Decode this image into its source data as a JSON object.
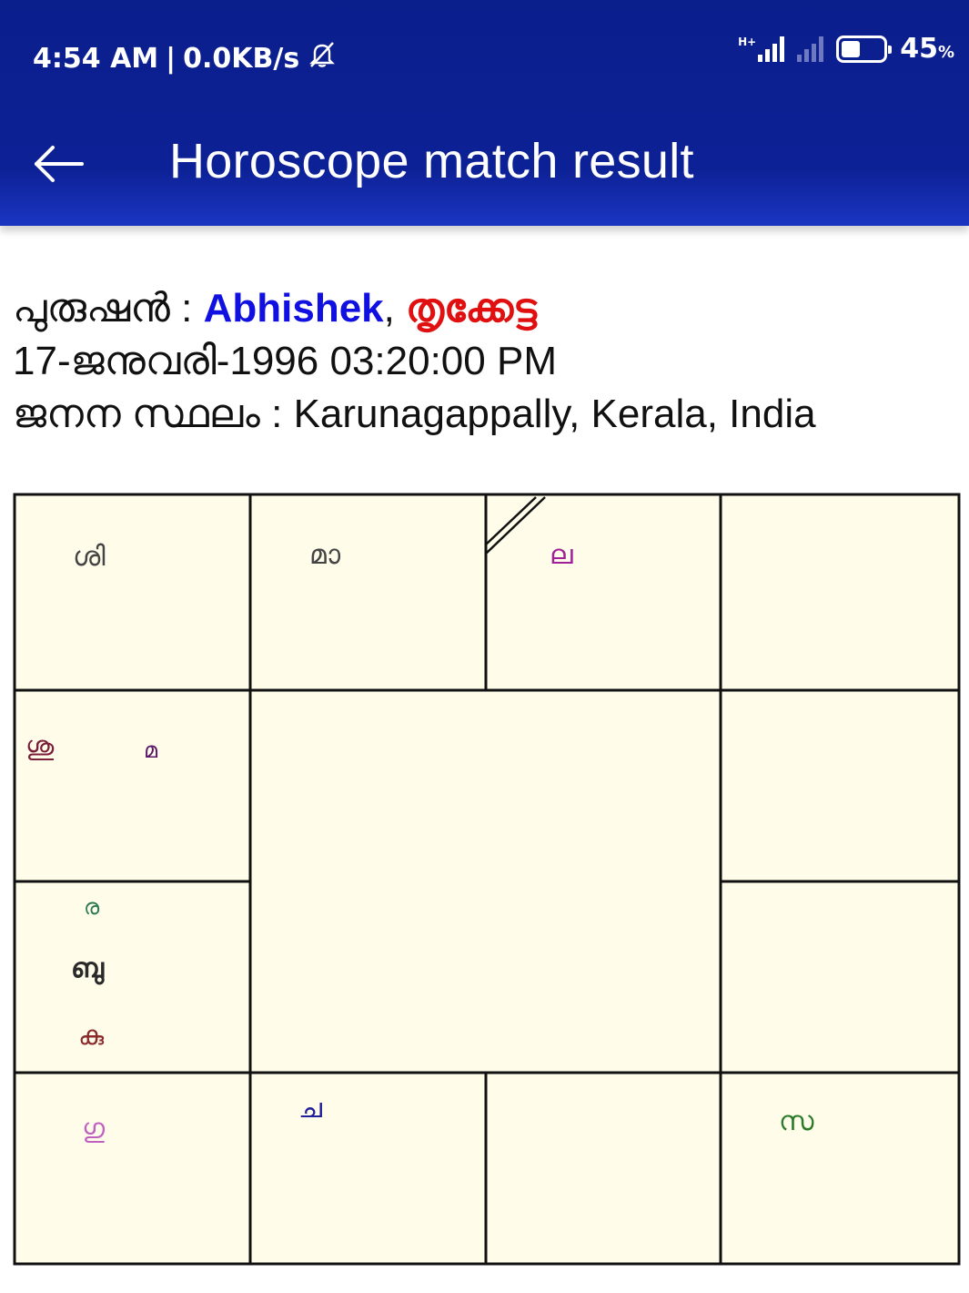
{
  "status_bar": {
    "time": "4:54 AM",
    "separator": "|",
    "speed": "0.0KB/s",
    "network_label": "H+",
    "battery_level": 0.45,
    "battery_text": "45",
    "battery_unit": "%"
  },
  "app_bar": {
    "title": "Horoscope match result",
    "back_icon": "arrow-left-icon"
  },
  "person": {
    "role_label": "പുരുഷൻ",
    "colon": " : ",
    "name": "Abhishek",
    "comma": ", ",
    "star": "തൃക്കേട്ട",
    "birth_datetime": "17-ജനുവരി-1996 03:20:00 PM",
    "place_label": "ജനന സ്ഥലം",
    "place": "Karunagappally, Kerala, India"
  },
  "chart": {
    "background": "#fffdea",
    "cells": {
      "c0": {
        "items": [
          {
            "text": "ശി",
            "color": "#444444"
          }
        ]
      },
      "c1": {
        "items": [
          {
            "text": "മാ",
            "color": "#444444"
          }
        ]
      },
      "c2": {
        "items": [
          {
            "text": "ല",
            "color": "#a0209a"
          }
        ]
      },
      "c4": {
        "items": [
          {
            "text": "ശു",
            "color": "#7a1e3a"
          },
          {
            "text": "മ",
            "color": "#5a1868"
          }
        ]
      },
      "c6": {
        "items": [
          {
            "text": "ര",
            "color": "#2e7a55"
          },
          {
            "text": "ബു",
            "color": "#2a2a2a"
          },
          {
            "text": "കു",
            "color": "#8a2a2a"
          }
        ]
      },
      "c8": {
        "items": [
          {
            "text": "ഗു",
            "color": "#c060c0"
          }
        ]
      },
      "c9": {
        "items": [
          {
            "text": "ച",
            "color": "#20209a"
          }
        ]
      },
      "c11": {
        "items": [
          {
            "text": "സ",
            "color": "#2a7a2a"
          }
        ]
      }
    }
  }
}
